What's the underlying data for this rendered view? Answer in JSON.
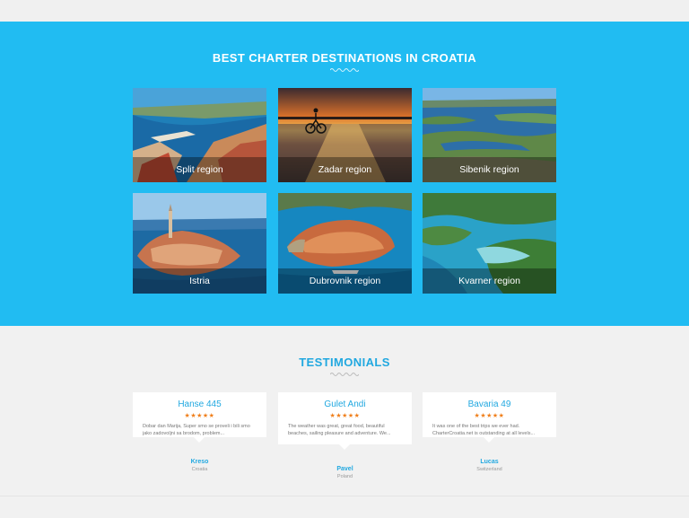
{
  "destinations": {
    "title": "BEST CHARTER DESTINATIONS IN CROATIA",
    "cards": [
      {
        "label": "Split region"
      },
      {
        "label": "Zadar region"
      },
      {
        "label": "Sibenik region"
      },
      {
        "label": "Istria"
      },
      {
        "label": "Dubrovnik region"
      },
      {
        "label": "Kvarner region"
      }
    ]
  },
  "testimonials": {
    "title": "TESTIMONIALS",
    "items": [
      {
        "boat": "Hanse 445",
        "stars": "★★★★★",
        "quote": "Dobar dan Marija, Super smo se proveli i bili smo jako zadovoljni sa brodom, problem...",
        "author": "Kreso",
        "country": "Croatia"
      },
      {
        "boat": "Gulet Andi",
        "stars": "★★★★★",
        "quote": "The weather was great, great food, beautiful beaches, sailing pleasure and adventure. We...",
        "author": "Pavel",
        "country": "Poland"
      },
      {
        "boat": "Bavaria 49",
        "stars": "★★★★★",
        "quote": "It was one of the best trips we ever had. CharterCroatia.net is outstanding at all levels...",
        "author": "Lucas",
        "country": "Switzerland"
      }
    ]
  },
  "colors": {
    "accent": "#21bcf2",
    "heading_blue": "#21a8e0",
    "stars": "#f07f1b"
  }
}
